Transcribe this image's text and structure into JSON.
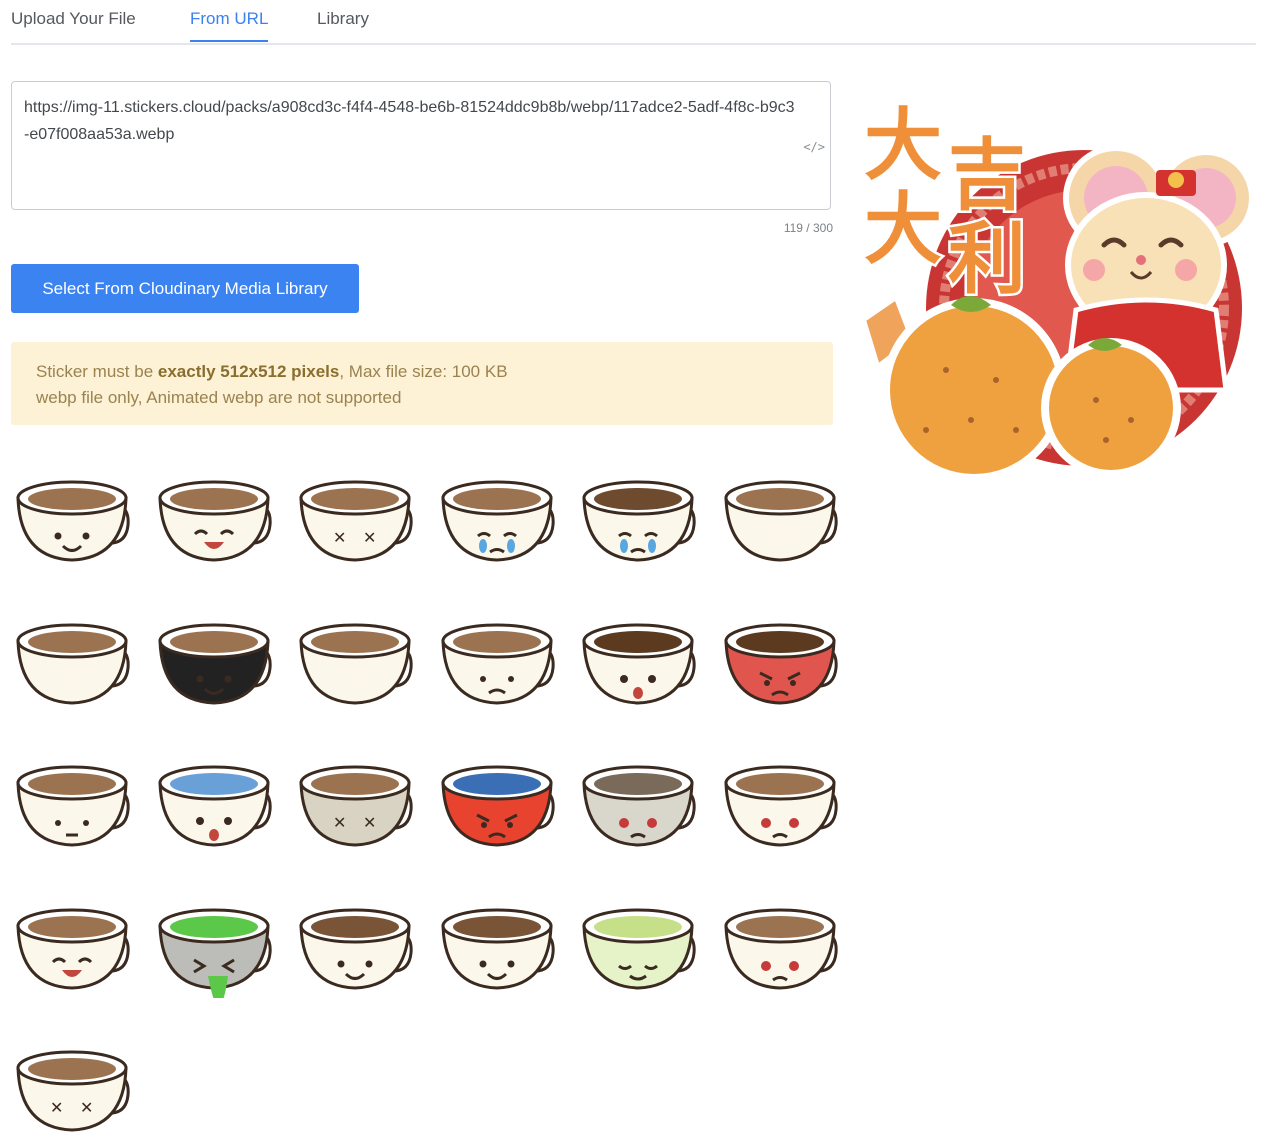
{
  "tabs": [
    {
      "label": "Upload Your File",
      "active": false
    },
    {
      "label": "From URL",
      "active": true
    },
    {
      "label": "Library",
      "active": false
    }
  ],
  "url_input": {
    "value": "https://img-11.stickers.cloud/packs/a908cd3c-f4f4-4548-be6b-81524ddc9b8b/webp/117adce2-5adf-4f8c-b9c3-e07f008aa53a.webp",
    "icon": "code-icon",
    "counter": "119 / 300"
  },
  "library_button": {
    "label": "Select From Cloudinary Media Library"
  },
  "notice": {
    "line1_prefix": "Sticker must be ",
    "line1_bold": "exactly 512x512 pixels",
    "line1_suffix": ", Max file size: 100 KB",
    "line2": "webp file only, Animated webp are not supported"
  },
  "colors": {
    "accent": "#3a83f1",
    "notice_bg": "#fdf1d6",
    "notice_text": "#9b8350"
  },
  "stickers": [
    {
      "name": "coffee-smile",
      "cup": "#fbf7ea",
      "liquid": "#9c7350",
      "face": "smile"
    },
    {
      "name": "coffee-laugh",
      "cup": "#fbf7ea",
      "liquid": "#9c7350",
      "face": "laugh"
    },
    {
      "name": "coffee-tilted-dizzy",
      "cup": "#fbf7ea",
      "liquid": "#9c7350",
      "face": "dizzy"
    },
    {
      "name": "coffee-crying",
      "cup": "#fbf7ea",
      "liquid": "#9c7350",
      "face": "cry"
    },
    {
      "name": "coffee-spilled-crying",
      "cup": "#fbf7ea",
      "liquid": "#6e4a2e",
      "face": "cry"
    },
    {
      "name": "coffee-latte-heart",
      "cup": "#fbf7ea",
      "liquid": "#9c7350",
      "face": "heart"
    },
    {
      "name": "coffee-broken-heart",
      "cup": "#fbf7ea",
      "liquid": "#9c7350",
      "face": "heart"
    },
    {
      "name": "coffee-with-black-mug-love",
      "cup": "#222222",
      "liquid": "#9c7350",
      "face": "smile"
    },
    {
      "name": "coffee-latte-cookie",
      "cup": "#fbf7ea",
      "liquid": "#9c7350",
      "face": "heart"
    },
    {
      "name": "coffee-steaming-sad",
      "cup": "#fbf7ea",
      "liquid": "#9c7350",
      "face": "sad"
    },
    {
      "name": "coffee-splash-shocked",
      "cup": "#fbf7ea",
      "liquid": "#5c3a20",
      "face": "shock"
    },
    {
      "name": "coffee-red-angry",
      "cup": "#e0554e",
      "liquid": "#5c3a20",
      "face": "angry"
    },
    {
      "name": "coffee-confused",
      "cup": "#fbf7ea",
      "liquid": "#9c7350",
      "face": "flat"
    },
    {
      "name": "coffee-rainbow",
      "cup": "#fbf7ea",
      "liquid": "#6aa0d8",
      "face": "shock"
    },
    {
      "name": "coffee-laptop-dead",
      "cup": "#d9d3c4",
      "liquid": "#9c7350",
      "face": "dead"
    },
    {
      "name": "coffee-red-mug-furious",
      "cup": "#e8432f",
      "liquid": "#3b6fb5",
      "face": "angry"
    },
    {
      "name": "coffee-low-battery",
      "cup": "#d9d6cc",
      "liquid": "#7a6a5a",
      "face": "tired"
    },
    {
      "name": "coffee-laptop-night",
      "cup": "#fbf7ea",
      "liquid": "#9c7350",
      "face": "tired"
    },
    {
      "name": "coffee-spotlight",
      "cup": "#fbf7ea",
      "liquid": "#9c7350",
      "face": "laugh"
    },
    {
      "name": "coffee-green-sick",
      "cup": "#bcbcb8",
      "liquid": "#5cc84a",
      "face": "sick"
    },
    {
      "name": "coffee-togo-wave",
      "cup": "#fbf7ea",
      "liquid": "#7a5436",
      "face": "smile"
    },
    {
      "name": "coffee-togo-dance",
      "cup": "#fbf7ea",
      "liquid": "#7a5436",
      "face": "smile"
    },
    {
      "name": "coffee-green-tea",
      "cup": "#e6f2c8",
      "liquid": "#c6e08a",
      "face": "content"
    },
    {
      "name": "coffee-phone",
      "cup": "#fbf7ea",
      "liquid": "#9c7350",
      "face": "tired"
    },
    {
      "name": "coffee-phone-dead",
      "cup": "#fbf7ea",
      "liquid": "#9c7350",
      "face": "dead"
    }
  ],
  "preview": {
    "name": "rat-lucky-new-year",
    "chars": [
      "大",
      "吉",
      "大",
      "利"
    ]
  }
}
